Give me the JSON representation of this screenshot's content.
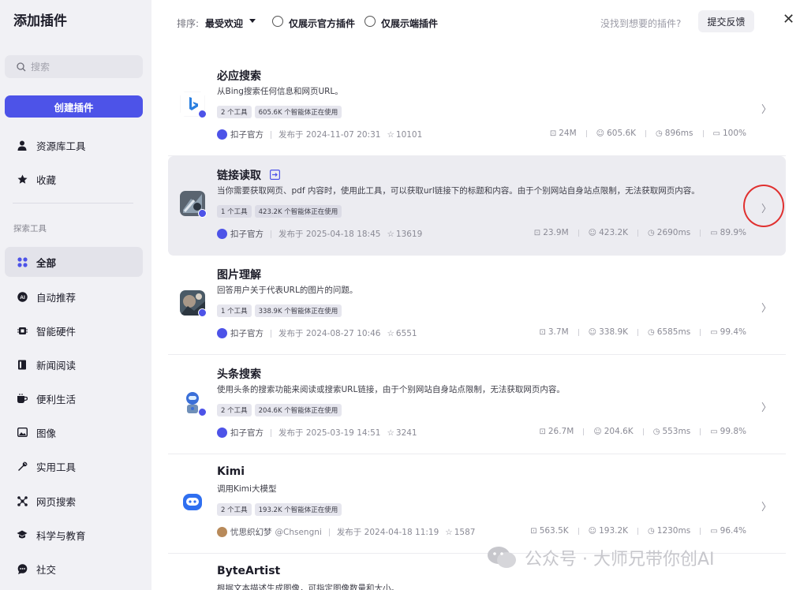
{
  "sidebar": {
    "title": "添加插件",
    "search_placeholder": "搜索",
    "create_label": "创建插件",
    "items": [
      {
        "label": "资源库工具",
        "icon": "user-icon"
      },
      {
        "label": "收藏",
        "icon": "star-icon"
      }
    ],
    "section_label": "探索工具",
    "categories": [
      {
        "label": "全部",
        "icon": "grid-icon",
        "active": true
      },
      {
        "label": "自动推荐",
        "icon": "ai-icon"
      },
      {
        "label": "智能硬件",
        "icon": "chip-icon"
      },
      {
        "label": "新闻阅读",
        "icon": "book-icon"
      },
      {
        "label": "便利生活",
        "icon": "cup-icon"
      },
      {
        "label": "图像",
        "icon": "image-icon"
      },
      {
        "label": "实用工具",
        "icon": "wrench-icon"
      },
      {
        "label": "网页搜索",
        "icon": "network-icon"
      },
      {
        "label": "科学与教育",
        "icon": "graduation-cap-icon"
      },
      {
        "label": "社交",
        "icon": "chat-icon"
      }
    ]
  },
  "topbar": {
    "sort_label": "排序:",
    "sort_value": "最受欢迎",
    "filter_official": "仅展示官方插件",
    "filter_edge": "仅展示端插件",
    "no_find": "没找到想要的插件?",
    "feedback_label": "提交反馈",
    "close_symbol": "✕"
  },
  "plugins": [
    {
      "name": "必应搜索",
      "desc": "从Bing搜索任何信息和网页URL。",
      "tools": "2 个工具",
      "usage": "605.6K 个智能体正在使用",
      "author": "扣子官方",
      "published": "发布于 2024-11-07 20:31",
      "stars": "10101",
      "calls": "24M",
      "bots": "605.6K",
      "latency": "896ms",
      "success": "100%",
      "logo": "bing-logo"
    },
    {
      "name": "链接读取",
      "desc": "当你需要获取网页、pdf 内容时，使用此工具，可以获取url链接下的标题和内容。由于个别网站自身站点限制，无法获取网页内容。",
      "tools": "1 个工具",
      "usage": "423.2K 个智能体正在使用",
      "author": "扣子官方",
      "published": "发布于 2025-04-18 18:45",
      "stars": "13619",
      "calls": "23.9M",
      "bots": "423.2K",
      "latency": "2690ms",
      "success": "89.9%",
      "logo": "link-logo"
    },
    {
      "name": "图片理解",
      "desc": "回答用户关于代表URL的图片的问题。",
      "tools": "1 个工具",
      "usage": "338.9K 个智能体正在使用",
      "author": "扣子官方",
      "published": "发布于 2024-08-27 10:46",
      "stars": "6551",
      "calls": "3.7M",
      "bots": "338.9K",
      "latency": "6585ms",
      "success": "99.4%",
      "logo": "image-logo"
    },
    {
      "name": "头条搜索",
      "desc": "使用头条的搜索功能来阅读或搜索URL链接，由于个别网站自身站点限制，无法获取网页内容。",
      "tools": "2 个工具",
      "usage": "204.6K 个智能体正在使用",
      "author": "扣子官方",
      "published": "发布于 2025-03-19 14:51",
      "stars": "3241",
      "calls": "26.7M",
      "bots": "204.6K",
      "latency": "553ms",
      "success": "99.8%",
      "logo": "robot-logo"
    },
    {
      "name": "Kimi",
      "desc": "调用Kimi大模型",
      "tools": "2 个工具",
      "usage": "193.2K 个智能体正在使用",
      "author": "忧思织幻梦",
      "handle": "@Chsengni",
      "published": "发布于 2024-04-18 11:19",
      "stars": "1587",
      "calls": "563.5K",
      "bots": "193.2K",
      "latency": "1230ms",
      "success": "96.4%",
      "logo": "kimi-logo"
    },
    {
      "name": "ByteArtist",
      "desc": "根据文本描述生成图像，可指定图像数量和大小。"
    }
  ],
  "watermark": "公众号 · 大师兄带你创AI",
  "colors": {
    "accent": "#4d53e8",
    "highlight_ring": "#e0302f",
    "sidebar_bg": "#f1f1f5"
  }
}
